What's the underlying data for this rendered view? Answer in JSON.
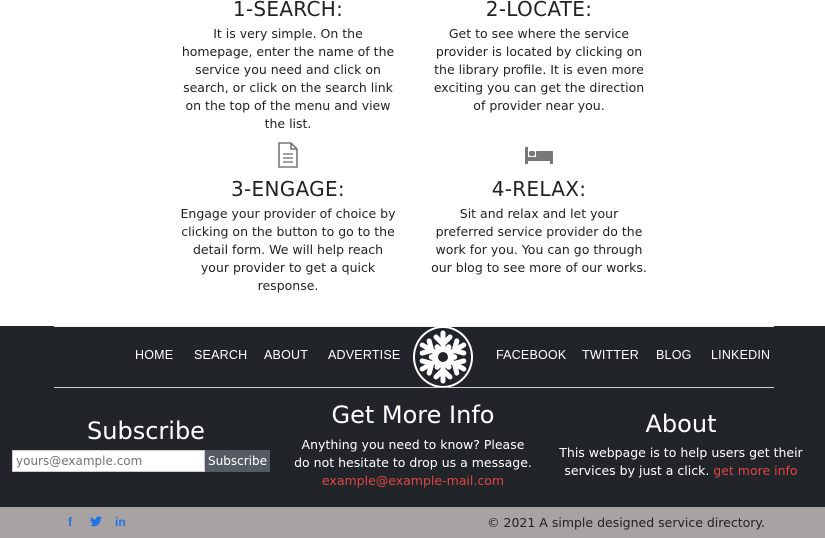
{
  "steps": [
    {
      "title": "1-SEARCH:",
      "text": "It is very simple. On the homepage, enter the name of the service you need and click on search, or click on the search link on the top of the menu and view the list."
    },
    {
      "title": "2-LOCATE:",
      "text": "Get to see where the service provider is located by clicking on the library profile. It is even more exciting you can get the direction of provider near you."
    },
    {
      "title": "3-ENGAGE:",
      "text": "Engage your provider of choice by clicking on the button to go to the detail form. We will help reach your provider to get a quick response.",
      "icon": "document-icon"
    },
    {
      "title": "4-RELAX:",
      "text": "Sit and relax and let your preferred service provider do the work for you. You can go through our blog to see more of our works.",
      "icon": "bed-icon"
    }
  ],
  "nav": {
    "left": [
      "HOME",
      "SEARCH",
      "ABOUT",
      "ADVERTISE"
    ],
    "right": [
      "FACEBOOK",
      "TWITTER",
      "BLOG",
      "LINKEDIN"
    ],
    "logo_icon": "snowflake-icon"
  },
  "subscribe": {
    "title": "Subscribe",
    "placeholder": "yours@example.com",
    "button": "Subscribe"
  },
  "more_info": {
    "title": "Get More Info",
    "text": "Anything you need to know? Please do not hesitate to drop us a message.",
    "email": "example@example-mail.com"
  },
  "about": {
    "title": "About",
    "text": "This webpage is to help users get their services by just a click.",
    "link": "get more info"
  },
  "social_icons": [
    "facebook-icon",
    "twitter-icon",
    "linkedin-icon"
  ],
  "copyright": "© 2021 A simple designed service directory.",
  "colors": {
    "footer_bg": "#212529",
    "link_red": "#e04545",
    "social_blue": "#1f74e8",
    "bottom_bar": "#a8a3a3"
  }
}
